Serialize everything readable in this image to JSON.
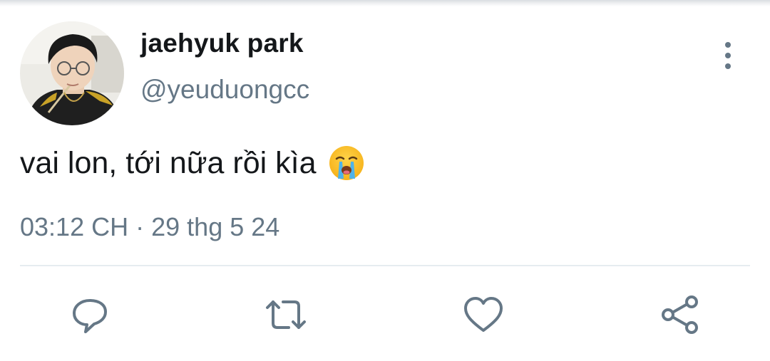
{
  "tweet": {
    "display_name": "jaehyuk park",
    "handle": "@yeuduongcc",
    "text": "vai lon, tới nữa rồi kìa",
    "emoji": "loudly-crying-face",
    "time": "03:12 CH",
    "separator": "·",
    "date": "29 thg 5 24"
  },
  "actions": [
    {
      "name": "reply",
      "icon": "speech-bubble-icon"
    },
    {
      "name": "retweet",
      "icon": "retweet-icon"
    },
    {
      "name": "like",
      "icon": "heart-icon"
    },
    {
      "name": "share",
      "icon": "share-icon"
    }
  ],
  "colors": {
    "text": "#14171a",
    "secondary": "#657786",
    "divider": "#e6ecf0",
    "background": "#ffffff"
  }
}
